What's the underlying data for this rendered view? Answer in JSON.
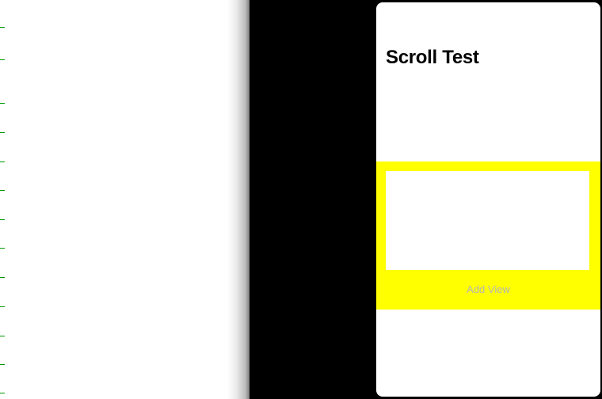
{
  "card": {
    "title": "Scroll Test"
  },
  "actions": {
    "add_view_label": "Add View"
  },
  "left_markers": {
    "positions": [
      34,
      75,
      130,
      167,
      204,
      240,
      277,
      313,
      350,
      387,
      424,
      460,
      496
    ]
  }
}
